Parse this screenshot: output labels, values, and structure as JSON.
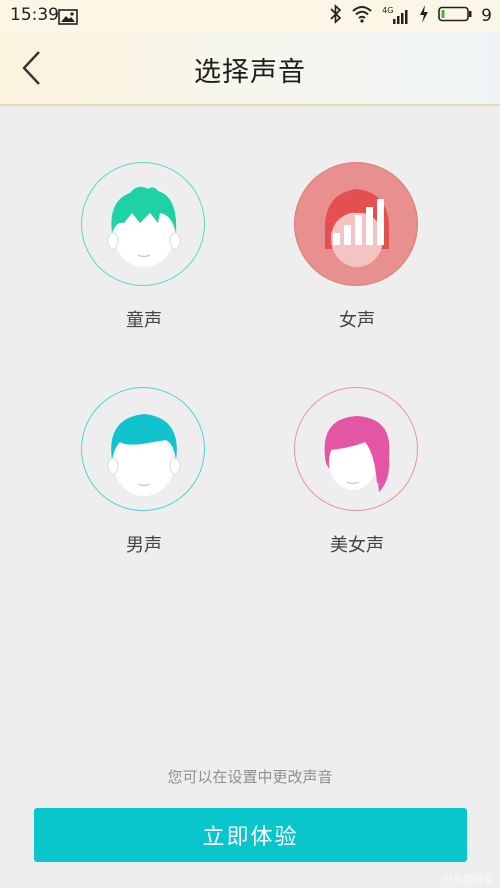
{
  "status_bar": {
    "time": "15:39",
    "network": "4G",
    "battery_level": "9",
    "icons": [
      "image-icon",
      "bluetooth-icon",
      "wifi-icon",
      "signal-icon",
      "charging-icon",
      "battery-icon"
    ]
  },
  "header": {
    "title": "选择声音",
    "back_icon": "chevron-left-icon"
  },
  "voices": [
    {
      "label": "童声",
      "selected": false,
      "ring_color": "#5fd6c4",
      "hair_color": "#1ed2a6"
    },
    {
      "label": "女声",
      "selected": true,
      "fill_color": "#e7908f",
      "hair_color": "#e4504f"
    },
    {
      "label": "男声",
      "selected": false,
      "ring_color": "#4fd3d6",
      "hair_color": "#11c3cc"
    },
    {
      "label": "美女声",
      "selected": false,
      "ring_color": "#e98fb6",
      "hair_color": "#e456a4"
    }
  ],
  "hint": "您可以在设置中更改声音",
  "cta_label": "立即体验",
  "watermark": "什么值得买",
  "colors": {
    "accent": "#09c5cc",
    "background": "#eeeeee"
  }
}
